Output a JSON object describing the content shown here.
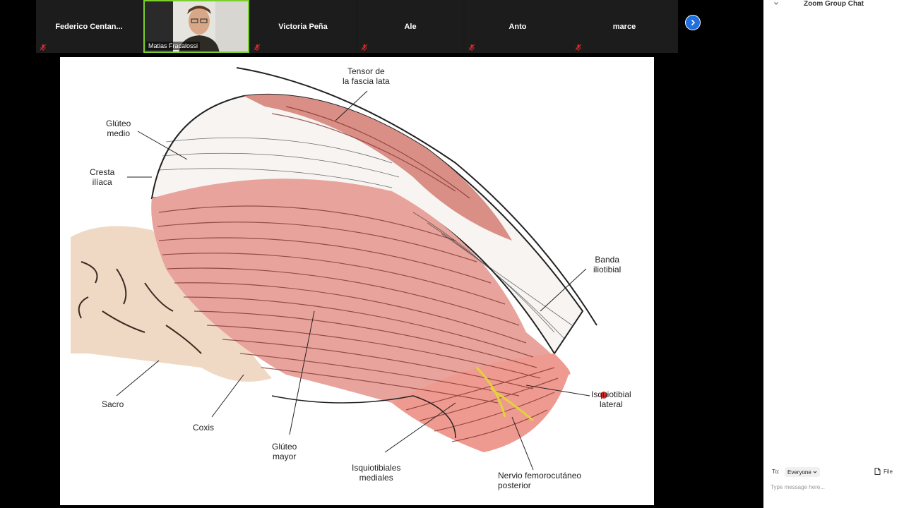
{
  "participants": [
    {
      "name": "Federico  Centan...",
      "muted": true
    },
    {
      "name": "Matias Fracalossi",
      "muted": false,
      "video": true
    },
    {
      "name": "Victoria Peña",
      "muted": true
    },
    {
      "name": "Ale",
      "muted": true
    },
    {
      "name": "Anto",
      "muted": true
    },
    {
      "name": "marce",
      "muted": true
    }
  ],
  "slide": {
    "labels": {
      "tensor": "Tensor de\nla fascia lata",
      "gluteo_medio": "Glúteo\nmedio",
      "cresta": "Cresta\nilíaca",
      "banda": "Banda\niliotibial",
      "isquio_lateral": "Isquiotibial\nlateral",
      "sacro": "Sacro",
      "coxis": "Coxis",
      "gluteo_mayor": "Glúteo\nmayor",
      "isquio_mediales": "Isquiotibiales\nmediales",
      "nervio": "Nervio femorocutáneo\nposterior"
    }
  },
  "chat": {
    "title": "Zoom Group Chat",
    "to_label": "To:",
    "recipient": "Everyone",
    "file_label": "File",
    "placeholder": "Type message here..."
  },
  "colors": {
    "muscle": "#e8a49c",
    "muscle_dark": "#7a2f2a",
    "bone": "#f0d9c4",
    "nerve": "#e2d23c",
    "active_speaker": "#7ccf2f",
    "accent_blue": "#1f6fde",
    "mic_red": "#e02828"
  }
}
